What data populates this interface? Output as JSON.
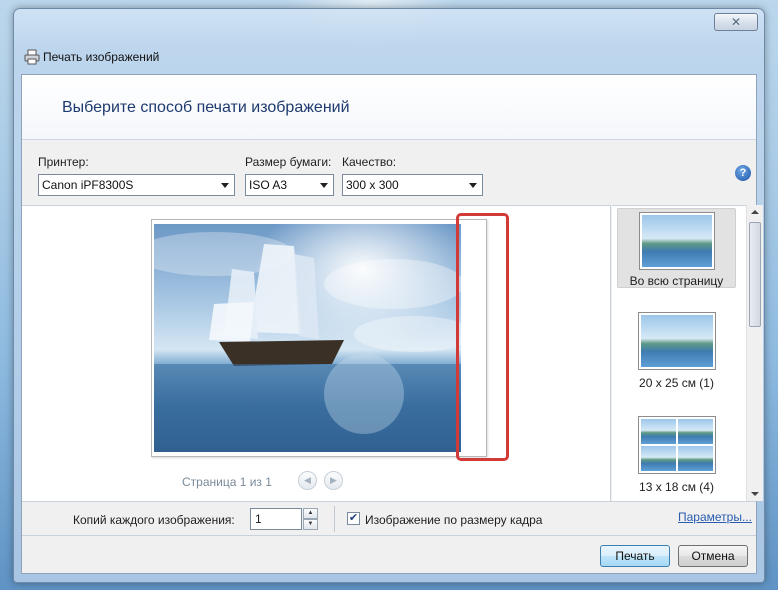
{
  "window": {
    "title": "Печать изображений",
    "close_label": "✕"
  },
  "header": {
    "title": "Выберите способ печати изображений"
  },
  "settings": {
    "printer_label": "Принтер:",
    "printer_value": "Canon iPF8300S",
    "paper_label": "Размер бумаги:",
    "paper_value": "ISO A3",
    "quality_label": "Качество:",
    "quality_value": "300 x 300",
    "help_label": "?"
  },
  "preview": {
    "page_status": "Страница 1 из 1",
    "prev_glyph": "◀",
    "next_glyph": "▶"
  },
  "layouts": [
    {
      "label": "Во всю страницу",
      "selected": true
    },
    {
      "label": "20 x 25 см (1)",
      "selected": false
    },
    {
      "label": "13 x 18 см (4)",
      "selected": false
    }
  ],
  "bottom": {
    "copies_label": "Копий каждого изображения:",
    "copies_value": "1",
    "spin_up": "▲",
    "spin_down": "▼",
    "fit_checkbox_mark": "✔",
    "fit_label": "Изображение по размеру кадра",
    "options_link": "Параметры..."
  },
  "actions": {
    "print_label": "Печать",
    "cancel_label": "Отмена"
  },
  "colors": {
    "highlight_border": "#d23a3a",
    "header_title": "#1e3a6e",
    "link": "#2a5db0"
  }
}
